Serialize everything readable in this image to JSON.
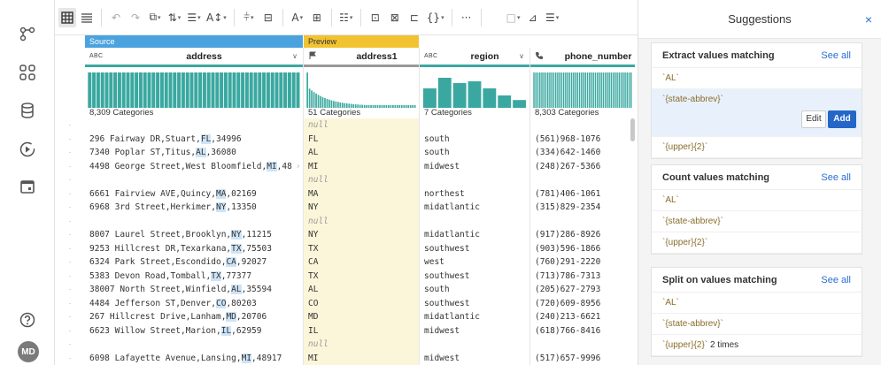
{
  "nav": {
    "avatar_initials": "MD"
  },
  "toolbar": {
    "icons": [
      "grid-icon",
      "list-icon",
      "undo-icon",
      "redo-icon",
      "text-type-icon",
      "filter-icon",
      "rows-icon",
      "sort-icon",
      "split-icon",
      "merge-icon",
      "font-icon",
      "table-icon",
      "format-icon",
      "pivot-icon",
      "group-icon",
      "nest-icon",
      "code-icon",
      "more-icon",
      "square-icon",
      "chart-icon",
      "settings-icon"
    ],
    "more_label": "···",
    "curly_label": "{}"
  },
  "grid": {
    "columns": [
      {
        "key": "address",
        "source_label": "Source",
        "source_color": "#4aa3df",
        "type": "ABC",
        "name": "address",
        "has_dropdown": true,
        "categories": "8,309 Categories"
      },
      {
        "key": "address1",
        "source_label": "Preview",
        "source_color": "#f2c330",
        "type": "flag",
        "name": "address1",
        "has_dropdown": false,
        "categories": "51 Categories"
      },
      {
        "key": "region",
        "source_label": "",
        "source_color": "",
        "type": "ABC",
        "name": "region",
        "has_dropdown": true,
        "categories": "7 Categories"
      },
      {
        "key": "phone",
        "source_label": "",
        "source_color": "",
        "type": "phone",
        "name": "phone_number",
        "has_dropdown": false,
        "categories": "8,303 Categories"
      }
    ],
    "rows": [
      {
        "address": "",
        "address1": "null",
        "region": "",
        "phone": ""
      },
      {
        "address": "296 Fairway DR,Stuart,FL,34996",
        "hl": "FL",
        "address1": "FL",
        "region": "south",
        "phone": "(561)968-1076"
      },
      {
        "address": "7340 Poplar ST,Titus,AL,36080",
        "hl": "AL",
        "address1": "AL",
        "region": "south",
        "phone": "(334)642-1460"
      },
      {
        "address": "4498 George Street,West Bloomfield,MI,48",
        "hl": "MI",
        "address1": "MI",
        "region": "midwest",
        "phone": "(248)267-5366"
      },
      {
        "address": "",
        "address1": "null",
        "region": "",
        "phone": ""
      },
      {
        "address": "6661 Fairview AVE,Quincy,MA,02169",
        "hl": "MA",
        "address1": "MA",
        "region": "northest",
        "phone": "(781)406-1061"
      },
      {
        "address": "6968 3rd Street,Herkimer,NY,13350",
        "hl": "NY",
        "address1": "NY",
        "region": "midatlantic",
        "phone": "(315)829-2354"
      },
      {
        "address": "",
        "address1": "null",
        "region": "",
        "phone": ""
      },
      {
        "address": "8007 Laurel Street,Brooklyn,NY,11215",
        "hl": "NY",
        "address1": "NY",
        "region": "midatlantic",
        "phone": "(917)286-8926"
      },
      {
        "address": "9253 Hillcrest DR,Texarkana,TX,75503",
        "hl": "TX",
        "address1": "TX",
        "region": "southwest",
        "phone": "(903)596-1866"
      },
      {
        "address": "6324 Park Street,Escondido,CA,92027",
        "hl": "CA",
        "address1": "CA",
        "region": "west",
        "phone": "(760)291-2220"
      },
      {
        "address": "5383 Devon Road,Tomball,TX,77377",
        "hl": "TX",
        "address1": "TX",
        "region": "southwest",
        "phone": "(713)786-7313"
      },
      {
        "address": "38007 North Street,Winfield,AL,35594",
        "hl": "AL",
        "address1": "AL",
        "region": "south",
        "phone": "(205)627-2793"
      },
      {
        "address": "4484 Jefferson ST,Denver,CO,80203",
        "hl": "CO",
        "address1": "CO",
        "region": "southwest",
        "phone": "(720)609-8956"
      },
      {
        "address": "267 Hillcrest Drive,Lanham,MD,20706",
        "hl": "MD",
        "address1": "MD",
        "region": "midatlantic",
        "phone": "(240)213-6621"
      },
      {
        "address": "6623 Willow Street,Marion,IL,62959",
        "hl": "IL",
        "address1": "IL",
        "region": "midwest",
        "phone": "(618)766-8416"
      },
      {
        "address": "",
        "address1": "null",
        "region": "",
        "phone": ""
      },
      {
        "address": "6098 Lafayette Avenue,Lansing,MI,48917",
        "hl": "MI",
        "address1": "MI",
        "region": "midwest",
        "phone": "(517)657-9996"
      }
    ]
  },
  "suggestions": {
    "title": "Suggestions",
    "close": "×",
    "cards": [
      {
        "title": "Extract values matching",
        "see_all": "See all",
        "items": [
          {
            "text": "`AL`",
            "extra": "",
            "active": false
          },
          {
            "text": "`{state-abbrev}`",
            "extra": "",
            "active": true
          },
          {
            "text": "`{upper}{2}`",
            "extra": "",
            "active": false
          }
        ]
      },
      {
        "title": "Count values matching",
        "see_all": "See all",
        "items": [
          {
            "text": "`AL`",
            "extra": "",
            "active": false
          },
          {
            "text": "`{state-abbrev}`",
            "extra": "",
            "active": false
          },
          {
            "text": "`{upper}{2}`",
            "extra": "",
            "active": false
          }
        ]
      },
      {
        "title": "Split on values matching",
        "see_all": "See all",
        "items": [
          {
            "text": "`AL`",
            "extra": "",
            "active": false
          },
          {
            "text": "`{state-abbrev}`",
            "extra": "",
            "active": false
          },
          {
            "text": "`{upper}{2}`",
            "extra": " 2 times",
            "active": false
          }
        ]
      }
    ],
    "edit_label": "Edit",
    "add_label": "Add"
  }
}
